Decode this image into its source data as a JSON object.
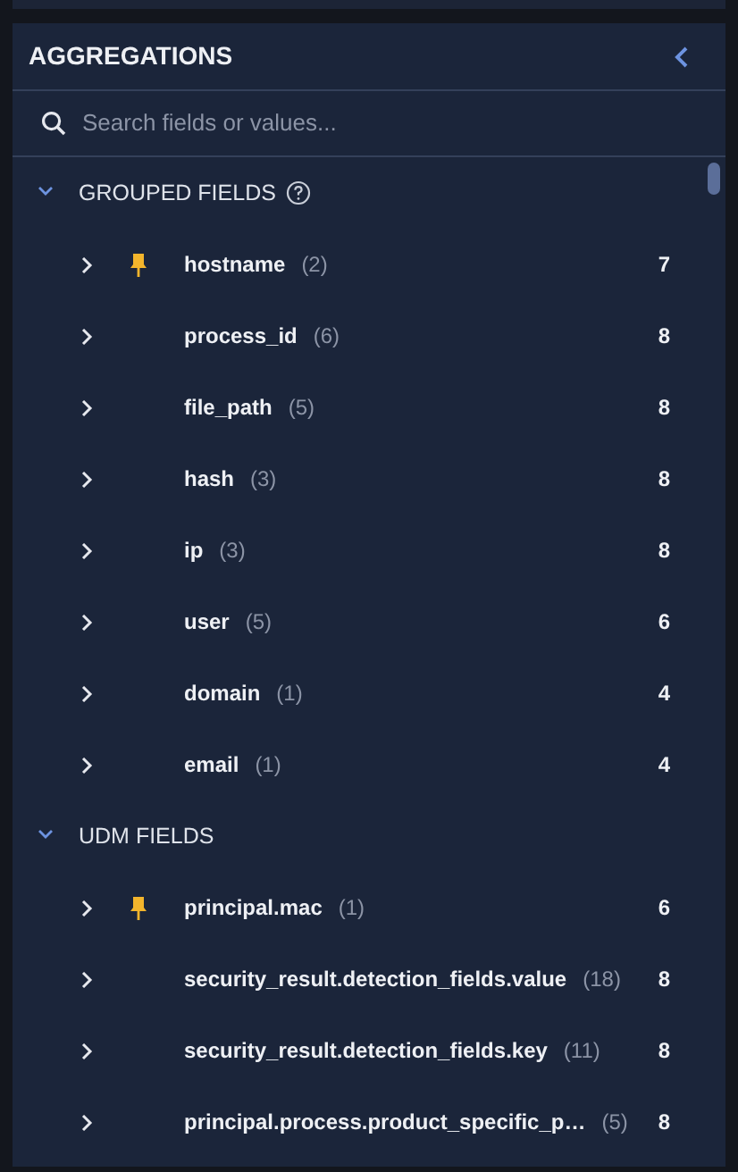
{
  "panel": {
    "title": "AGGREGATIONS"
  },
  "search": {
    "placeholder": "Search fields or values..."
  },
  "sections": [
    {
      "title": "GROUPED FIELDS",
      "help": true,
      "expanded": true,
      "fields": [
        {
          "name": "hostname",
          "count": "(2)",
          "value": "7",
          "pinned": true,
          "expanded": false
        },
        {
          "name": "process_id",
          "count": "(6)",
          "value": "8",
          "pinned": false,
          "expanded": false
        },
        {
          "name": "file_path",
          "count": "(5)",
          "value": "8",
          "pinned": false,
          "expanded": false
        },
        {
          "name": "hash",
          "count": "(3)",
          "value": "8",
          "pinned": false,
          "expanded": false
        },
        {
          "name": "ip",
          "count": "(3)",
          "value": "8",
          "pinned": false,
          "expanded": false
        },
        {
          "name": "user",
          "count": "(5)",
          "value": "6",
          "pinned": false,
          "expanded": false
        },
        {
          "name": "domain",
          "count": "(1)",
          "value": "4",
          "pinned": false,
          "expanded": false
        },
        {
          "name": "email",
          "count": "(1)",
          "value": "4",
          "pinned": false,
          "expanded": false
        }
      ]
    },
    {
      "title": "UDM FIELDS",
      "help": false,
      "expanded": true,
      "fields": [
        {
          "name": "principal.mac",
          "count": "(1)",
          "value": "6",
          "pinned": true,
          "expanded": false
        },
        {
          "name": "security_result.detection_fields.value",
          "count": "(18)",
          "value": "8",
          "pinned": false,
          "expanded": false
        },
        {
          "name": "security_result.detection_fields.key",
          "count": "(11)",
          "value": "8",
          "pinned": false,
          "expanded": false
        },
        {
          "name": "principal.process.product_specific_p…",
          "count": "(5)",
          "value": "8",
          "pinned": false,
          "expanded": false
        }
      ]
    }
  ]
}
